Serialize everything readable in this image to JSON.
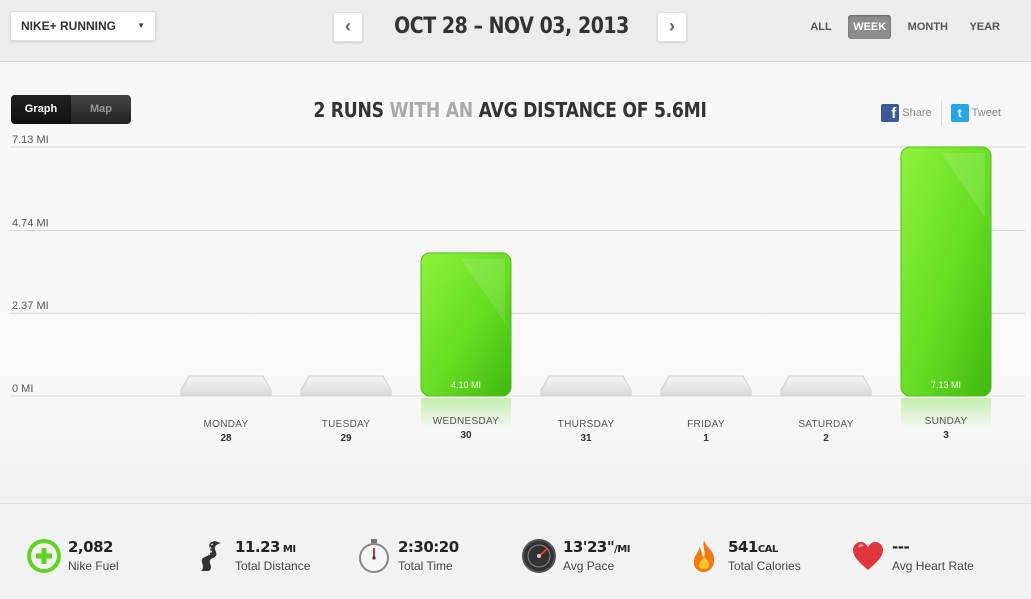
{
  "header": {
    "app_selector": "NIKE+ RUNNING",
    "prev_icon": "chevron-left-icon",
    "next_icon": "chevron-right-icon",
    "date_range": "OCT 28 – NOV 03, 2013",
    "period_tabs": [
      "ALL",
      "WEEK",
      "MONTH",
      "YEAR"
    ],
    "active_period": "WEEK"
  },
  "view_toggle": {
    "graph": "Graph",
    "map": "Map",
    "active": "Graph"
  },
  "summary": {
    "part1": "2 RUNS",
    "part2": " WITH AN ",
    "part3": "AVG DISTANCE OF 5.6MI"
  },
  "share": {
    "facebook": "Share",
    "twitter": "Tweet"
  },
  "chart_data": {
    "type": "bar",
    "categories": [
      "MONDAY",
      "TUESDAY",
      "WEDNESDAY",
      "THURSDAY",
      "FRIDAY",
      "SATURDAY",
      "SUNDAY"
    ],
    "dates": [
      "28",
      "29",
      "30",
      "31",
      "1",
      "2",
      "3"
    ],
    "values": [
      0,
      0,
      4.1,
      0,
      0,
      0,
      7.13
    ],
    "data_labels": [
      "",
      "",
      "4.10 MI",
      "",
      "",
      "",
      "7.13 MI"
    ],
    "yticks": [
      0,
      2.37,
      4.74,
      7.13
    ],
    "ytick_labels": [
      "0 MI",
      "2.37 MI",
      "4.74 MI",
      "7.13 MI"
    ],
    "ylim": [
      0,
      7.13
    ],
    "bar_color": "#66dd22",
    "empty_color": "#e6e6e6",
    "grid": true
  },
  "stats": [
    {
      "value": "2,082",
      "unit": "",
      "label": "Nike Fuel",
      "icon": "nike-fuel-icon"
    },
    {
      "value": "11.23",
      "unit": " MI",
      "label": "Total Distance",
      "icon": "road-icon"
    },
    {
      "value": "2:30:20",
      "unit": "",
      "label": "Total Time",
      "icon": "stopwatch-icon"
    },
    {
      "value": "13'23\"",
      "unit": "/MI",
      "label": "Avg Pace",
      "icon": "speedometer-icon"
    },
    {
      "value": "541",
      "unit": "CAL",
      "label": "Total Calories",
      "icon": "flame-icon"
    },
    {
      "value": "---",
      "unit": "",
      "label": "Avg Heart Rate",
      "icon": "heart-icon"
    }
  ]
}
